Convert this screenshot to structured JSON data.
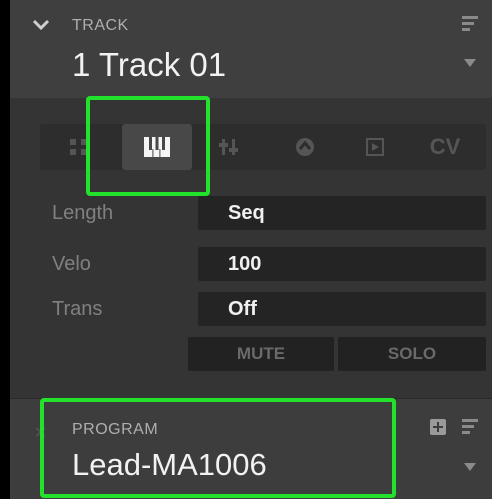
{
  "track": {
    "section_label": "TRACK",
    "title": "1 Track 01"
  },
  "tabs": [
    {
      "name": "grid",
      "label": "",
      "icon": "grid-icon"
    },
    {
      "name": "keys",
      "label": "",
      "icon": "piano-keys-icon",
      "active": true
    },
    {
      "name": "mixer",
      "label": "",
      "icon": "mixer-icon"
    },
    {
      "name": "automation",
      "label": "",
      "icon": "automation-icon"
    },
    {
      "name": "plugin",
      "label": "",
      "icon": "plugin-icon"
    },
    {
      "name": "cv",
      "label": "CV"
    }
  ],
  "params": [
    {
      "label": "Length",
      "value": "Seq"
    },
    {
      "label": "Velo",
      "value": "100"
    },
    {
      "label": "Trans",
      "value": "Off"
    }
  ],
  "buttons": {
    "mute": "MUTE",
    "solo": "SOLO"
  },
  "program": {
    "section_label": "PROGRAM",
    "title": "Lead-MA1006"
  },
  "colors": {
    "highlight": "#22e22b",
    "background": "#3a3a3a"
  }
}
